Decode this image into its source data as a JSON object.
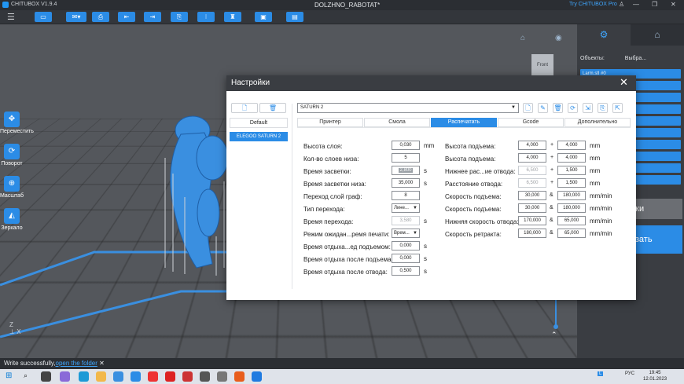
{
  "app": {
    "name": "CHITUBOX V1.9.4",
    "document": "DOLZHNO_RABOTAT*",
    "promo": "Try CHITUBOX Pro"
  },
  "toolbar_icons": [
    "open-file-icon",
    "save-file-icon",
    "undo-icon",
    "redo-icon",
    "new-icon",
    "copy-icon",
    "grid-icon",
    "rotate-icon",
    "view-icon",
    "settings-icon"
  ],
  "left_tools": [
    {
      "label": "Переместить",
      "icon": "move-icon"
    },
    {
      "label": "Поворот",
      "icon": "rotate-icon"
    },
    {
      "label": "Масштаб",
      "icon": "scale-icon"
    },
    {
      "label": "Зеркало",
      "icon": "mirror-icon"
    }
  ],
  "viewcube": {
    "label": "Front"
  },
  "right_panel": {
    "objects_label": "Объекты:",
    "select_label": "Выбра...",
    "first_object": "Larm.stl #0",
    "supports_button": "йки",
    "slice_button": "езать"
  },
  "status": {
    "message": "Write successfully,",
    "link": "open the folder"
  },
  "taskbar": {
    "lang": "РУС",
    "time": "19:45",
    "date": "12.01.2023"
  },
  "dialog": {
    "title": "Настройки",
    "presets": [
      "Default",
      "ELEGOO SATURN 2"
    ],
    "printer": "SATURN 2",
    "tabs": [
      "Принтер",
      "Смола",
      "Распечатать",
      "Gcode",
      "Дополнительно"
    ],
    "active_tab": 2,
    "left_fields": [
      {
        "label": "Высота слоя:",
        "value": "0,030",
        "unit": "mm"
      },
      {
        "label": "Кол-во слоев низа:",
        "value": "5",
        "unit": ""
      },
      {
        "label": "Время засветки:",
        "value": "2,800",
        "unit": "s"
      },
      {
        "label": "Время засветки низа:",
        "value": "35,000",
        "unit": "s"
      },
      {
        "label": "Переход слой граф:",
        "value": "8",
        "unit": ""
      },
      {
        "label": "Тип перехода:",
        "value": "Лине...",
        "unit": ""
      },
      {
        "label": "Время перехода:",
        "value": "3,580",
        "unit": "s"
      },
      {
        "label": "Режим ожидан...ремя печати:",
        "value": "Врем...",
        "unit": ""
      },
      {
        "label": "Время отдыха...ед подъемом:",
        "value": "0,000",
        "unit": "s"
      },
      {
        "label": "Время отдыха после подъема:",
        "value": "0,000",
        "unit": "s"
      },
      {
        "label": "Время отдыха после отвода:",
        "value": "0,500",
        "unit": "s"
      }
    ],
    "right_fields": [
      {
        "label": "Высота подъема:",
        "a": "4,000",
        "op": "+",
        "b": "4,000",
        "unit": "mm"
      },
      {
        "label": "Высота подъема:",
        "a": "4,000",
        "op": "+",
        "b": "4,000",
        "unit": "mm"
      },
      {
        "label": "Нижнее рас...ие отвода:",
        "a": "6,500",
        "op": "+",
        "b": "1,500",
        "unit": "mm"
      },
      {
        "label": "Расстояние отвода:",
        "a": "6,500",
        "op": "+",
        "b": "1,500",
        "unit": "mm"
      },
      {
        "label": "Скорость подъема:",
        "a": "30,000",
        "op": "&",
        "b": "180,000",
        "unit": "mm/min"
      },
      {
        "label": "Скорость подъема:",
        "a": "30,000",
        "op": "&",
        "b": "180,000",
        "unit": "mm/min"
      },
      {
        "label": "Нижняя скорость отвода:",
        "a": "170,000",
        "op": "&",
        "b": "65,000",
        "unit": "mm/min"
      },
      {
        "label": "Скорость ретракта:",
        "a": "180,000",
        "op": "&",
        "b": "65,000",
        "unit": "mm/min"
      }
    ]
  }
}
